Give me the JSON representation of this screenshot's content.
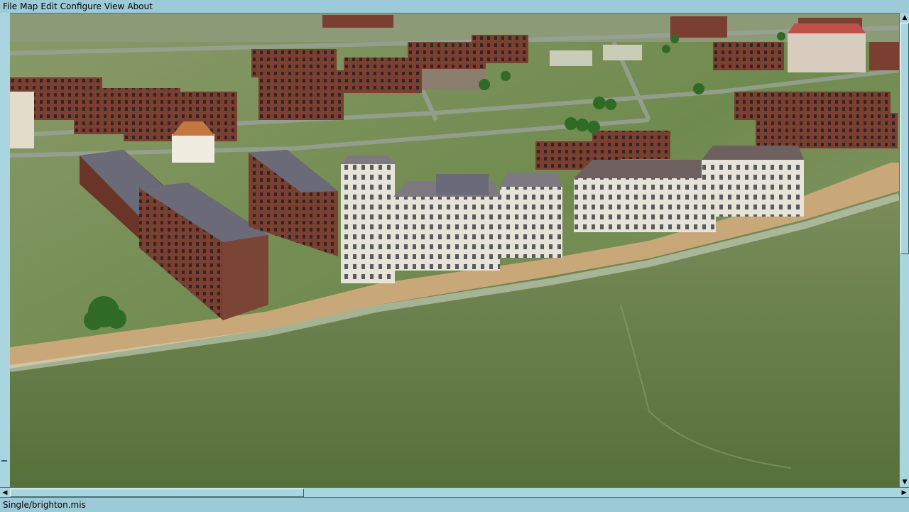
{
  "menu": {
    "items": [
      "File",
      "Map",
      "Edit",
      "Configure",
      "View",
      "About"
    ]
  },
  "scene": {
    "description_icon": "terrain-3d-view",
    "colors": {
      "sea": "#5f7a42",
      "beach": "#c8a878",
      "grass": "#7c8f58",
      "brick": "#7a3f30",
      "stucco": "#e6e4d8",
      "roof": "#5a4f4a"
    }
  },
  "scrollbars": {
    "left_arrow_icon": "arrow-left-icon",
    "right_arrow_icon": "arrow-right-icon",
    "up_arrow_icon": "arrow-up-icon",
    "down_arrow_icon": "arrow-down-icon"
  },
  "status": {
    "mission_file": "Single/brighton.mis"
  }
}
